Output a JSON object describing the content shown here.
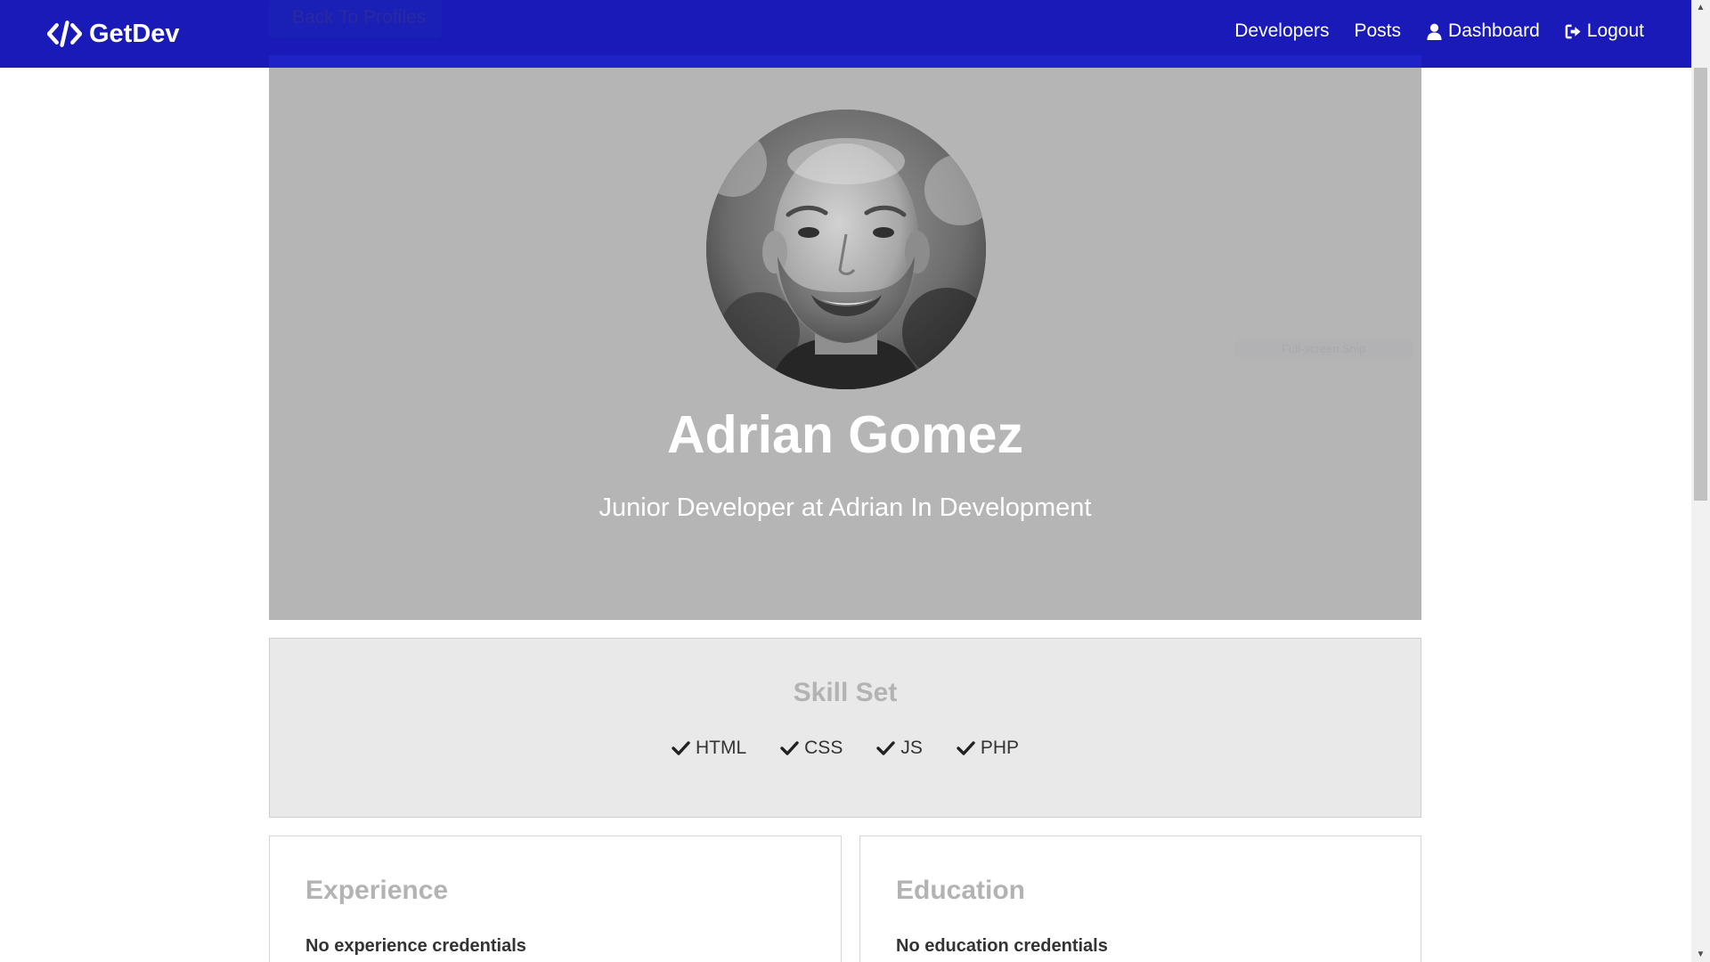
{
  "navbar": {
    "brand": "GetDev",
    "links": [
      {
        "label": "Developers",
        "icon": ""
      },
      {
        "label": "Posts",
        "icon": ""
      },
      {
        "label": "Dashboard",
        "icon": "user-icon"
      },
      {
        "label": "Logout",
        "icon": "sign-out-icon"
      }
    ]
  },
  "back_button": {
    "label": "Back To Profiles"
  },
  "profile": {
    "name": "Adrian Gomez",
    "status": "Junior Developer at Adrian In Development"
  },
  "snip_hint": "Full-screen Snip",
  "skills": {
    "title": "Skill Set",
    "items": [
      "HTML",
      "CSS",
      "JS",
      "PHP"
    ]
  },
  "experience": {
    "title": "Experience",
    "empty_text": "No experience credentials"
  },
  "education": {
    "title": "Education",
    "empty_text": "No education credentials"
  },
  "colors": {
    "navbar": "#1a1ab8",
    "profile_bg": "#b5b5b5",
    "skills_bg": "#e9e9e9"
  }
}
